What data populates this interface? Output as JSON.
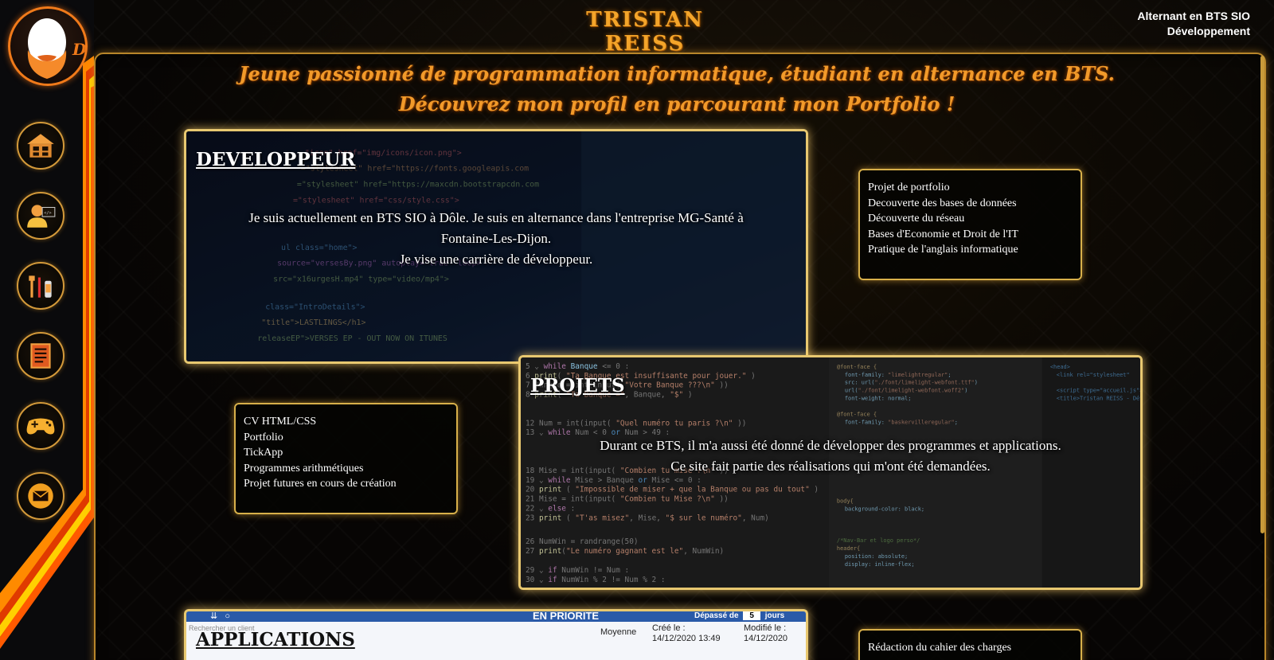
{
  "header": {
    "title": "TRISTAN REISS",
    "role_line1": "Alternant en BTS SIO",
    "role_line2": "Développement"
  },
  "tagline": {
    "line1": "Jeune passionné de programmation informatique, étudiant en alternance en BTS.",
    "line2": "Découvrez mon profil en parcourant mon Portfolio !"
  },
  "sidebar": {
    "items": [
      {
        "icon": "home-icon"
      },
      {
        "icon": "developer-profile-icon"
      },
      {
        "icon": "tools-icon"
      },
      {
        "icon": "document-icon"
      },
      {
        "icon": "gamepad-icon"
      },
      {
        "icon": "mail-icon"
      }
    ]
  },
  "developpeur": {
    "title": "DEVELOPPEUR",
    "text_line1": "Je suis actuellement en BTS SIO à Dôle. Je suis en alternance dans l'entreprise MG-Santé à",
    "text_line2": "Fontaine-Les-Dijon.",
    "text_line3": "Je vise une carrière de développeur."
  },
  "developpeur_list": [
    "Projet de portfolio",
    "Decouverte des bases de données",
    "Découverte du réseau",
    "Bases d'Economie et Droit de l'IT",
    "Pratique de l'anglais informatique"
  ],
  "projets": {
    "title": "PROJETS",
    "text_line1": "Durant ce BTS, il m'a aussi été donné de développer des programmes et applications.",
    "text_line2": "Ce site fait partie des réalisations qui m'ont été demandées."
  },
  "projets_list": [
    "CV HTML/CSS",
    "Portfolio",
    "TickApp",
    "Programmes arithmétiques",
    "Projet futures en cours de création"
  ],
  "applications": {
    "title": "APPLICATIONS",
    "screenshot": {
      "search_placeholder": "Rechercher un client",
      "priority": "EN PRIORITE",
      "overdue": "Dépassé de",
      "overdue_value": "5",
      "days": "jours",
      "level": "Moyenne",
      "created_label": "Créé le :",
      "created_value": "14/12/2020 13:49",
      "modified_label": "Modifié le :",
      "modified_value": "14/12/2020"
    }
  },
  "applications_list_first": "Rédaction du cahier des charges",
  "colors": {
    "accent_gold": "#e8c870",
    "title_orange": "#f4a52a",
    "tagline_orange": "#f29a2a"
  }
}
